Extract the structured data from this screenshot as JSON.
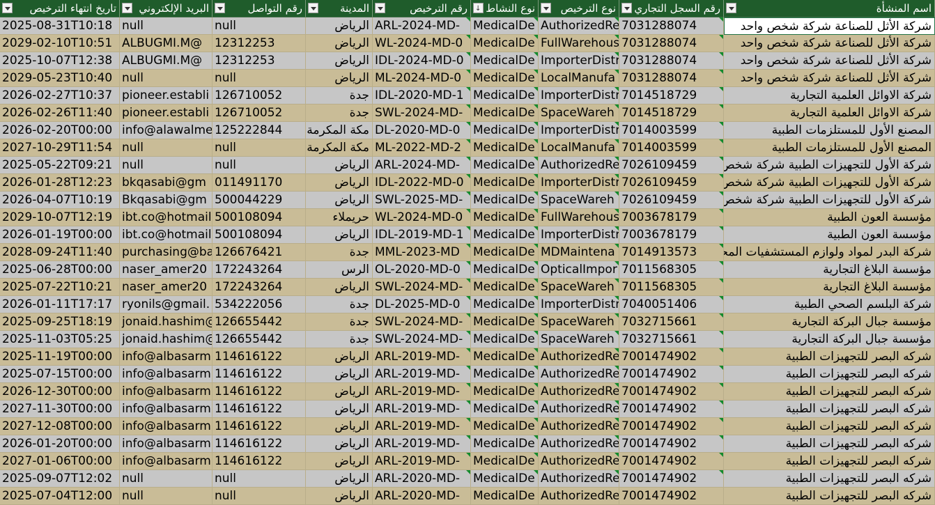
{
  "sheet": {
    "headers": [
      "تاريخ انتهاء الترخيص",
      "البريد الإلكتروني",
      "رقم التواصل",
      "المدينة",
      "رقم الترخيص",
      "نوع النشاط",
      "نوع الترخيص",
      "رقم السجل التجاري",
      "اسم المنشأة"
    ],
    "rows": [
      [
        "2025-08-31T10:18",
        "null",
        "null",
        "الرياض",
        "ARL-2024-MD-",
        "MedicalDe",
        "AuthorizedRe",
        "7031288074",
        "شركة الأثل للصناعة شركة شخص واحد"
      ],
      [
        "2029-02-10T10:51",
        "ALBUGMI.M@",
        "12312253",
        "الرياض",
        "WL-2024-MD-0",
        "MedicalDe",
        "FullWarehous",
        "7031288074",
        "شركة الأثل للصناعة شركة شخص واحد"
      ],
      [
        "2025-10-07T12:38",
        "ALBUGMI.M@",
        "12312253",
        "الرياض",
        "IDL-2024-MD-0",
        "MedicalDe",
        "ImporterDistr",
        "7031288074",
        "شركة الأثل للصناعة شركة شخص واحد"
      ],
      [
        "2029-05-23T10:40",
        "null",
        "null",
        "الرياض",
        "ML-2024-MD-0",
        "MedicalDe",
        "LocalManufa",
        "7031288074",
        "شركة الأثل للصناعة شركة شخص واحد"
      ],
      [
        "2026-02-27T10:37",
        "pioneer.establi",
        "126710052",
        "جدة",
        "IDL-2020-MD-1",
        "MedicalDe",
        "ImporterDistr",
        "7014518729",
        "شركة الاوائل العلمية التجارية"
      ],
      [
        "2026-02-26T11:40",
        "pioneer.establi",
        "126710052",
        "جدة",
        "SWL-2024-MD-",
        "MedicalDe",
        "SpaceWareh",
        "7014518729",
        "شركة الاوائل العلمية التجارية"
      ],
      [
        "2026-02-20T00:00",
        "info@alawalme",
        "125222844",
        "مكة المكرمة",
        "DL-2020-MD-0",
        "MedicalDe",
        "ImporterDistr",
        "7014003599",
        "المصنع الأول للمستلزمات الطبية"
      ],
      [
        "2027-10-29T11:54",
        "null",
        "null",
        "مكة المكرمة",
        "ML-2022-MD-2",
        "MedicalDe",
        "LocalManufa",
        "7014003599",
        "المصنع الأول للمستلزمات الطبية"
      ],
      [
        "2025-05-22T09:21",
        "null",
        "null",
        "الرياض",
        "ARL-2024-MD-",
        "MedicalDe",
        "AuthorizedRe",
        "7026109459",
        "شركة الأول للتجهيزات الطبية شركة شخص وا"
      ],
      [
        "2026-01-28T12:23",
        "bkqasabi@gm",
        "011491170",
        "الرياض",
        "IDL-2022-MD-0",
        "MedicalDe",
        "ImporterDistr",
        "7026109459",
        "شركة الأول للتجهيزات الطبية شركة شخص وا"
      ],
      [
        "2026-04-07T10:19",
        "Bkqasabi@gm",
        "500044229",
        "الرياض",
        "SWL-2025-MD-",
        "MedicalDe",
        "SpaceWareh",
        "7026109459",
        "شركة الأول للتجهيزات الطبية شركة شخص وا"
      ],
      [
        "2029-10-07T12:19",
        "ibt.co@hotmail",
        "500108094",
        "حريملاء",
        "WL-2024-MD-0",
        "MedicalDe",
        "FullWarehous",
        "7003678179",
        "مؤسسة العون الطبية"
      ],
      [
        "2026-01-19T00:00",
        "ibt.co@hotmail",
        "500108094",
        "الرياض",
        "IDL-2019-MD-1",
        "MedicalDe",
        "ImporterDistr",
        "7003678179",
        "مؤسسة العون الطبية"
      ],
      [
        "2028-09-24T11:40",
        "purchasing@ba",
        "126676421",
        "جدة",
        "MML-2023-MD",
        "MedicalDe",
        "MDMaintena",
        "7014913573",
        "شركة البدر لمواد ولوازم المستشفيات المحدوده"
      ],
      [
        "2025-06-28T00:00",
        "naser_amer20",
        "172243264",
        "الرس",
        "OL-2020-MD-0",
        "MedicalDe",
        "OpticalImpor",
        "7011568305",
        "مؤسسة البلاغ التجارية"
      ],
      [
        "2025-07-22T10:21",
        "naser_amer20",
        "172243264",
        "الرياض",
        "SWL-2024-MD-",
        "MedicalDe",
        "SpaceWareh",
        "7011568305",
        "مؤسسة البلاغ التجارية"
      ],
      [
        "2026-01-11T17:17",
        "ryonils@gmail.",
        "534222056",
        "جدة",
        "DL-2025-MD-0",
        "MedicalDe",
        "ImporterDistr",
        "7040051406",
        "شركة البلسم الصحي الطبية"
      ],
      [
        "2025-09-25T18:19",
        "jonaid.hashim@",
        "126655442",
        "جدة",
        "SWL-2024-MD-",
        "MedicalDe",
        "SpaceWareh",
        "7032715661",
        "مؤسسة جبال البركة التجارية"
      ],
      [
        "2025-11-03T05:25",
        "jonaid.hashim@",
        "126655442",
        "جدة",
        "SWL-2024-MD-",
        "MedicalDe",
        "SpaceWareh",
        "7032715661",
        "مؤسسة جبال البركة التجارية"
      ],
      [
        "2025-11-19T00:00",
        "info@albasarm",
        "114616122",
        "الرياض",
        "ARL-2019-MD-",
        "MedicalDe",
        "AuthorizedRe",
        "7001474902",
        "شركه البصر للتجهيزات الطبية"
      ],
      [
        "2025-07-15T00:00",
        "info@albasarm",
        "114616122",
        "الرياض",
        "ARL-2019-MD-",
        "MedicalDe",
        "AuthorizedRe",
        "7001474902",
        "شركه البصر للتجهيزات الطبية"
      ],
      [
        "2026-12-30T00:00",
        "info@albasarm",
        "114616122",
        "الرياض",
        "ARL-2019-MD-",
        "MedicalDe",
        "AuthorizedRe",
        "7001474902",
        "شركه البصر للتجهيزات الطبية"
      ],
      [
        "2027-11-30T00:00",
        "info@albasarm",
        "114616122",
        "الرياض",
        "ARL-2019-MD-",
        "MedicalDe",
        "AuthorizedRe",
        "7001474902",
        "شركه البصر للتجهيزات الطبية"
      ],
      [
        "2027-12-08T00:00",
        "info@albasarm",
        "114616122",
        "الرياض",
        "ARL-2019-MD-",
        "MedicalDe",
        "AuthorizedRe",
        "7001474902",
        "شركه البصر للتجهيزات الطبية"
      ],
      [
        "2026-01-20T00:00",
        "info@albasarm",
        "114616122",
        "الرياض",
        "ARL-2019-MD-",
        "MedicalDe",
        "AuthorizedRe",
        "7001474902",
        "شركه البصر للتجهيزات الطبية"
      ],
      [
        "2027-01-06T00:00",
        "info@albasarm",
        "114616122",
        "الرياض",
        "ARL-2019-MD-",
        "MedicalDe",
        "AuthorizedRe",
        "7001474902",
        "شركه البصر للتجهيزات الطبية"
      ],
      [
        "2025-09-07T12:02",
        "null",
        "null",
        "الرياض",
        "ARL-2020-MD-",
        "MedicalDe",
        "AuthorizedRe",
        "7001474902",
        "شركه البصر للتجهيزات الطبية"
      ],
      [
        "2025-07-04T12:00",
        "null",
        "null",
        "الرياض",
        "ARL-2020-MD-",
        "MedicalDe",
        "AuthorizedRe",
        "7001474902",
        "شركه البصر للتجهيزات الطبية"
      ]
    ]
  },
  "colors": {
    "header_bg": "#1f5c2b",
    "band_gray": "#c6c6c6",
    "band_tan": "#c9bc97",
    "comment_marker": "#138a2d"
  },
  "icons": {
    "filter": "dropdown-arrow-icon",
    "sorted_filter": "sort-descending-icon"
  }
}
